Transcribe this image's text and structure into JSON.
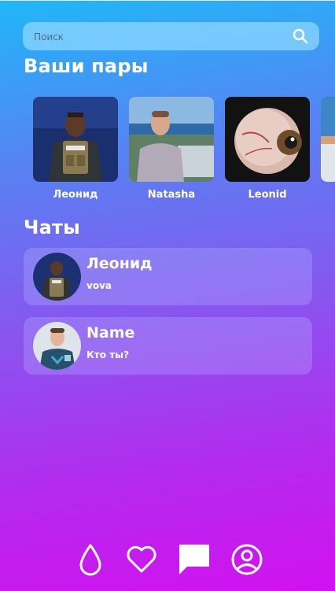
{
  "search": {
    "placeholder": "Поиск",
    "icon": "search-icon"
  },
  "matches": {
    "title": "Ваши пары",
    "items": [
      {
        "name": "Леонид"
      },
      {
        "name": "Natasha"
      },
      {
        "name": "Leonid"
      }
    ]
  },
  "chats": {
    "title": "Чаты",
    "items": [
      {
        "name": "Леонид",
        "last_message": "vova"
      },
      {
        "name": "Name",
        "last_message": "Кто ты?"
      }
    ]
  },
  "nav": {
    "items": [
      {
        "icon": "drop-icon"
      },
      {
        "icon": "heart-icon"
      },
      {
        "icon": "chat-bubble-icon"
      },
      {
        "icon": "profile-icon"
      }
    ]
  },
  "colors": {
    "gradient_top": "#21b7f8",
    "gradient_bottom": "#d211f0",
    "text": "#ffffff"
  }
}
